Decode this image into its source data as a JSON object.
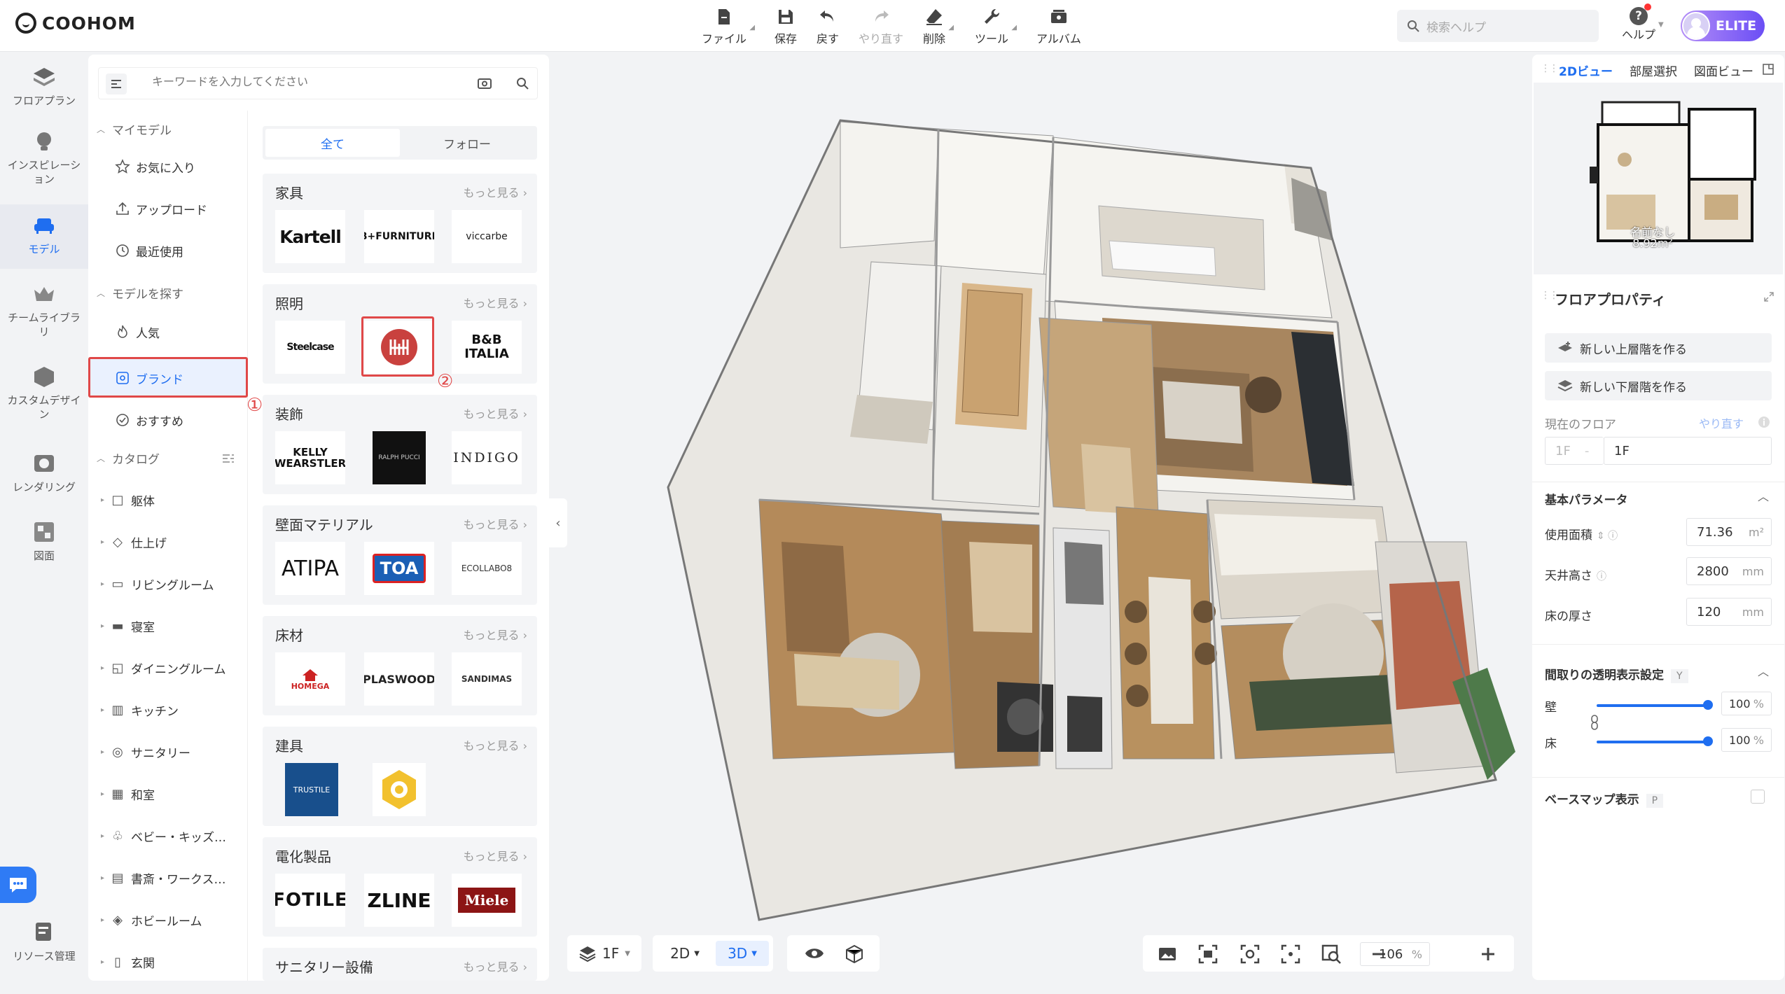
{
  "app": {
    "brand": "COOHOM"
  },
  "toolbar": {
    "file": "ファイル",
    "save": "保存",
    "undo": "戻す",
    "redo": "やり直す",
    "delete": "削除",
    "tools": "ツール",
    "album": "アルバム"
  },
  "header": {
    "search_placeholder": "検索ヘルプ",
    "help": "ヘルプ",
    "plan": "ELITE"
  },
  "leftnav": {
    "floorplan": "フロアプラン",
    "inspiration": "インスピレーション",
    "model": "モデル",
    "team_library": "チームライブラリ",
    "custom_design": "カスタムデザイン",
    "rendering": "レンダリング",
    "drawing": "図面",
    "resources": "リソース管理"
  },
  "panel": {
    "search_placeholder": "キーワードを入力してください",
    "my_models": "マイモデル",
    "favorites": "お気に入り",
    "upload": "アップロード",
    "recent": "最近使用",
    "find_models": "モデルを探す",
    "popular": "人気",
    "brand": "ブランド",
    "recommended": "おすすめ",
    "catalog": "カタログ",
    "catalog_items": [
      "躯体",
      "仕上げ",
      "リビングルーム",
      "寝室",
      "ダイニングルーム",
      "キッチン",
      "サニタリー",
      "和室",
      "ベビー・キッズ…",
      "書斎・ワークス…",
      "ホビールーム",
      "玄関"
    ],
    "annotation_1": "①",
    "annotation_2": "②",
    "tab_all": "全て",
    "tab_follow": "フォロー",
    "more": "もっと見る",
    "groups": [
      {
        "title": "家具",
        "brands": [
          "Kartell",
          "B+FURNITURE",
          "viccarbe"
        ]
      },
      {
        "title": "照明",
        "brands": [
          "Steelcase",
          "",
          "B&B ITALIA"
        ]
      },
      {
        "title": "装飾",
        "brands": [
          "KELLY WEARSTLER",
          "RALPH PUCCI",
          "INDIGO"
        ]
      },
      {
        "title": "壁面マテリアル",
        "brands": [
          "ATIPA",
          "TOA",
          "ECOLLABO8"
        ]
      },
      {
        "title": "床材",
        "brands": [
          "HOMEGA",
          "PLASWOOD",
          "SANDIMAS"
        ]
      },
      {
        "title": "建具",
        "brands": [
          "TRUSTILE",
          ""
        ]
      },
      {
        "title": "電化製品",
        "brands": [
          "FOTILE",
          "ZLINE",
          "Miele"
        ]
      },
      {
        "title": "サニタリー設備",
        "brands": []
      }
    ]
  },
  "canvas": {
    "floor": "1F",
    "view_2d": "2D",
    "view_3d": "3D",
    "zoom": "106",
    "zoom_unit": "%"
  },
  "right": {
    "tab_2d": "2Dビュー",
    "tab_room": "部屋選択",
    "tab_plan": "図面ビュー",
    "minimap_label": "名前なし",
    "minimap_area": "8.92m²",
    "floor_props": "フロアプロパティ",
    "new_upper": "新しい上層階を作る",
    "new_lower": "新しい下層階を作る",
    "current_floor": "現在のフロア",
    "redo": "やり直す",
    "floor_prefix": "1F",
    "floor_name": "1F",
    "basic_params": "基本パラメータ",
    "area_label": "使用面積",
    "area_value": "71.36",
    "area_unit": "m²",
    "ceiling_label": "天井高さ",
    "ceiling_value": "2800",
    "ceiling_unit": "mm",
    "floor_thick_label": "床の厚さ",
    "floor_thick_value": "120",
    "floor_thick_unit": "mm",
    "transparency": "間取りの透明表示設定",
    "transparency_key": "Y",
    "wall": "壁",
    "wall_value": "100",
    "floor": "床",
    "floor_value": "100",
    "pct": "%",
    "basemap": "ベースマップ表示",
    "basemap_key": "P"
  }
}
